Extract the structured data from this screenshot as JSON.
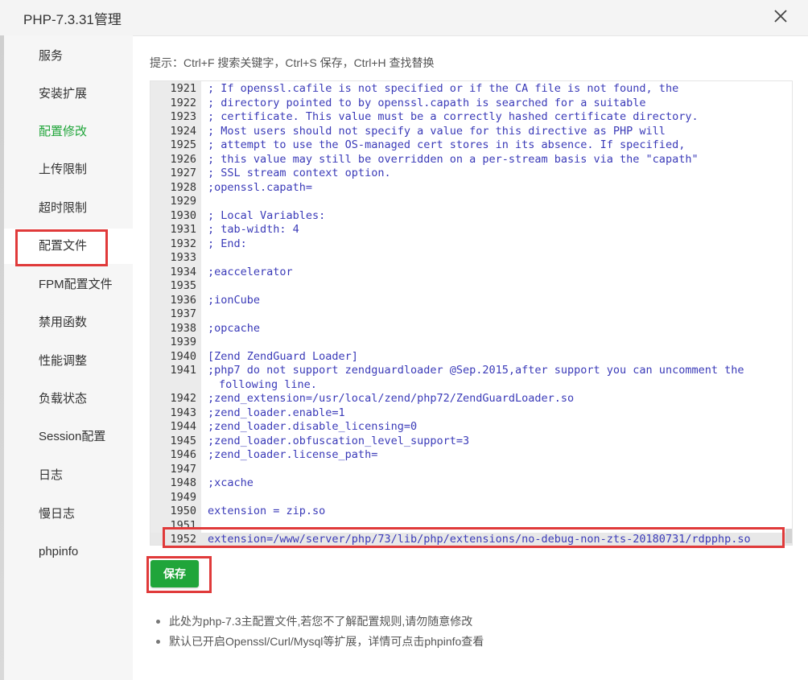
{
  "dialog": {
    "title": "PHP-7.3.31管理",
    "close_icon": "close-icon"
  },
  "sidebar": {
    "items": [
      {
        "label": "服务"
      },
      {
        "label": "安装扩展"
      },
      {
        "label": "配置修改"
      },
      {
        "label": "上传限制"
      },
      {
        "label": "超时限制"
      },
      {
        "label": "配置文件"
      },
      {
        "label": "FPM配置文件"
      },
      {
        "label": "禁用函数"
      },
      {
        "label": "性能调整"
      },
      {
        "label": "负载状态"
      },
      {
        "label": "Session配置"
      },
      {
        "label": "日志"
      },
      {
        "label": "慢日志"
      },
      {
        "label": "phpinfo"
      }
    ],
    "active_item": "配置文件",
    "accent_item": "配置修改"
  },
  "hint": "提示：Ctrl+F 搜索关键字，Ctrl+S 保存，Ctrl+H 查找替换",
  "editor": {
    "lines": [
      {
        "num": "1921",
        "text": "; If openssl.cafile is not specified or if the CA file is not found, the"
      },
      {
        "num": "1922",
        "text": "; directory pointed to by openssl.capath is searched for a suitable"
      },
      {
        "num": "1923",
        "text": "; certificate. This value must be a correctly hashed certificate directory."
      },
      {
        "num": "1924",
        "text": "; Most users should not specify a value for this directive as PHP will"
      },
      {
        "num": "1925",
        "text": "; attempt to use the OS-managed cert stores in its absence. If specified,"
      },
      {
        "num": "1926",
        "text": "; this value may still be overridden on a per-stream basis via the \"capath\""
      },
      {
        "num": "1927",
        "text": "; SSL stream context option."
      },
      {
        "num": "1928",
        "text": ";openssl.capath="
      },
      {
        "num": "1929",
        "text": ""
      },
      {
        "num": "1930",
        "text": "; Local Variables:"
      },
      {
        "num": "1931",
        "text": "; tab-width: 4"
      },
      {
        "num": "1932",
        "text": "; End:"
      },
      {
        "num": "1933",
        "text": ""
      },
      {
        "num": "1934",
        "text": ";eaccelerator"
      },
      {
        "num": "1935",
        "text": ""
      },
      {
        "num": "1936",
        "text": ";ionCube"
      },
      {
        "num": "1937",
        "text": ""
      },
      {
        "num": "1938",
        "text": ";opcache"
      },
      {
        "num": "1939",
        "text": ""
      },
      {
        "num": "1940",
        "text": "[Zend ZendGuard Loader]"
      },
      {
        "num": "1941",
        "text": ";php7 do not support zendguardloader @Sep.2015,after support you can uncomment the"
      },
      {
        "num": "",
        "text": "following line."
      },
      {
        "num": "1942",
        "text": ";zend_extension=/usr/local/zend/php72/ZendGuardLoader.so"
      },
      {
        "num": "1943",
        "text": ";zend_loader.enable=1"
      },
      {
        "num": "1944",
        "text": ";zend_loader.disable_licensing=0"
      },
      {
        "num": "1945",
        "text": ";zend_loader.obfuscation_level_support=3"
      },
      {
        "num": "1946",
        "text": ";zend_loader.license_path="
      },
      {
        "num": "1947",
        "text": ""
      },
      {
        "num": "1948",
        "text": ";xcache"
      },
      {
        "num": "1949",
        "text": ""
      },
      {
        "num": "1950",
        "text": "extension = zip.so"
      },
      {
        "num": "1951",
        "text": ""
      },
      {
        "num": "1952",
        "text": "extension=/www/server/php/73/lib/php/extensions/no-debug-non-zts-20180731/rdpphp.so"
      }
    ]
  },
  "save_label": "保存",
  "notes": [
    "此处为php-7.3主配置文件,若您不了解配置规则,请勿随意修改",
    "默认已开启Openssl/Curl/Mysql等扩展，详情可点击phpinfo查看"
  ],
  "colors": {
    "accent": "#20a53a",
    "highlight_box": "#e03a3a",
    "code_text": "#3a3ab8"
  }
}
